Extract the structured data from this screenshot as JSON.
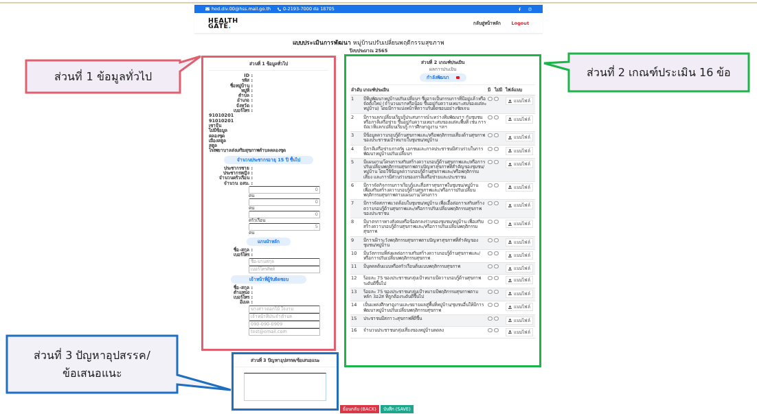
{
  "topbar": {
    "email": "hed.div.00@hss.mail.go.th",
    "phone": "0-2193-7000 ต่อ 18705"
  },
  "header": {
    "logo": {
      "line_1": "HEALTH",
      "line_2": "GATE",
      "dot": "."
    },
    "nav": [
      {
        "label": "กลับสู่หน้าหลัก",
        "kind": "link"
      },
      {
        "label": "Logout",
        "kind": "logout"
      }
    ]
  },
  "form": {
    "title": "**แบบประเมินการพัฒนา** หมู่บ้านปรับเปลี่ยนพฤติกรรมสุขภาพ",
    "subtitle": "ปีงบประมาณ 2565",
    "part_1": {
      "heading": "ส่วนที่ 1 ข้อมูลทั่วไป",
      "info_labels": [
        "ID :",
        "รหัส :",
        "ชื่อหมู่บ้าน :",
        "หมู่ที่ :",
        "ตำบล :",
        "อำเภอ :",
        "จังหวัด :",
        "เบอร์โทร :"
      ],
      "info_values": [
        "91010201",
        "91010201",
        "เขาจีน",
        "ไม่มีข้อมูล",
        "คลองขุด",
        "เมืองสตูล",
        "สตูล",
        "โรงพยาบาลส่งเสริมสุขภาพตำบลคลองขุด"
      ],
      "population": {
        "heading": "จำนวนประชากรอายุ 15 ปี ขึ้นไป",
        "labels": [
          "ประชากรชาย :",
          "ประชากรหญิง :",
          "จำนวนครัวเรือน :",
          "จำนวน อสม. :"
        ],
        "inputs": [
          {
            "value": "0",
            "unit": "คน"
          },
          {
            "value": "0",
            "unit": "คน"
          },
          {
            "value": "0",
            "unit": "ครัวเรือน"
          },
          {
            "value": "5",
            "unit": "คน"
          }
        ]
      },
      "leader": {
        "heading": "แกนนำหลัก",
        "labels": [
          "ชื่อ-สกุล :",
          "เบอร์โทร :"
        ],
        "placeholders": [
          "ชื่อ-นามสกุล",
          "เบอร์โทรศัพท์"
        ]
      },
      "officer": {
        "heading": "เจ้าหน้าที่ผู้รับผิดชอบ",
        "labels": [
          "ชื่อ-สกุล :",
          "ตำแหน่ง :",
          "เบอร์โทร :",
          "อีเมล :"
        ],
        "placeholders": [
          "นางสาวดอกไม้ ใจงาม",
          "เจ้าหน้าที่ประจำตำบล",
          "090-090-0909",
          "test@email.com"
        ]
      }
    },
    "part_2": {
      "heading": "ส่วนที่ 2 เกณฑ์ประเมิน",
      "result_label": "ผลการประเมิน",
      "result": {
        "label": "กำลังพัฒนา",
        "color": "#e8141b"
      },
      "columns": [
        "ลำดับ",
        "เกณฑ์ประเมิน",
        "มี",
        "ไม่มี",
        "ไฟล์แนบ"
      ],
      "rows": [
        {
          "no": "1",
          "criterion": "มีทีมพัฒนาหมู่บ้านปรับเปลี่ยนฯ ซึ่งอาจเป็นกรรมการที่มีอยู่แล้วหรือจัดตั้งใหม่ (จำนวนมากหรือน้อย ขึ้นอยู่กับความเหมาะสมของแต่ละหมู่บ้าน) โดยมีการแบ่งหน้าที่ความรับผิดชอบอย่างชัดเจน",
          "radios": [
            {
              "selected": false
            },
            {
              "selected": false
            }
          ],
          "attach": "แนบไฟล์"
        },
        {
          "no": "2",
          "criterion": "มีการแลกเปลี่ยนเรียนรู้ประสบการณ์ระหว่างทีมพัฒนาฯ กับชุมชนหรือภาคีเครือข่าย ขึ้นอยู่กับความเหมาะสมของแต่ละพื้นที่ เช่น การจัดเวทีแลกเปลี่ยนเรียนรู้ การศึกษาดูงาน ฯลฯ",
          "radios": [
            {
              "selected": false
            },
            {
              "selected": false
            }
          ],
          "attach": "แนบไฟล์"
        },
        {
          "no": "3",
          "criterion": "มีข้อมูลความรอบรู้ด้านสุขภาพและ/หรือพฤติกรรมเสี่ยงด้านสุขภาพของประชาชนเป้าหมายในชุมชน/หมู่บ้าน",
          "radios": [
            {
              "selected": false
            },
            {
              "selected": false
            }
          ],
          "attach": "แนบไฟล์"
        },
        {
          "no": "4",
          "criterion": "มีภาคีเครือข่ายภาครัฐ เอกชนและภาคประชาชนมีส่วนร่วมในการพัฒนาหมู่บ้านปรับเปลี่ยนฯ",
          "radios": [
            {
              "selected": false
            },
            {
              "selected": false
            }
          ],
          "attach": "แนบไฟล์"
        },
        {
          "no": "5",
          "criterion": "มีแผนงาน/โครงการเสริมสร้างความรอบรู้ด้านสุขภาพและ/หรือการปรับเปลี่ยนพฤติกรรมสุขภาพตามปัญหาสุขภาพที่สำคัญของชุมชน/หมู่บ้าน โดยใช้ข้อมูลความรอบรู้ด้านสุขภาพและ/หรือพฤติกรรมเสี่ยง และการมีส่วนร่วมของภาคีเครือข่ายและประชาชน",
          "radios": [
            {
              "selected": false
            },
            {
              "selected": false
            }
          ],
          "attach": "แนบไฟล์"
        },
        {
          "no": "6",
          "criterion": "มีการจัดกิจกรรมการเรียนรู้และสื่อสารสุขภาพในชุมชน/หมู่บ้าน เพื่อเสริมสร้างความรอบรู้ด้านสุขภาพและ/หรือการปรับเปลี่ยนพฤติกรรมสุขภาพตามแผนงาน/โครงการ",
          "radios": [
            {
              "selected": false
            },
            {
              "selected": false
            }
          ],
          "attach": "แนบไฟล์"
        },
        {
          "no": "7",
          "criterion": "มีการจัดสภาพแวดล้อมในชุมชน/หมู่บ้าน เพื่อเอื้อต่อการเสริมสร้างความรอบรู้ด้านสุขภาพและ/หรือการปรับเปลี่ยนพฤติกรรมสุขภาพของประชาชน",
          "radios": [
            {
              "selected": false
            },
            {
              "selected": false
            }
          ],
          "attach": "แนบไฟล์"
        },
        {
          "no": "8",
          "criterion": "มีมาตรการทางสังคมหรือข้อตกลงร่วมของชุมชน/หมู่บ้าน เพื่อเสริมสร้างความรอบรู้ด้านสุขภาพและ/หรือการปรับเปลี่ยนพฤติกรรมสุขภาพ",
          "radios": [
            {
              "selected": false
            },
            {
              "selected": false
            }
          ],
          "attach": "แนบไฟล์"
        },
        {
          "no": "9",
          "criterion": "มีการเฝ้าระวังพฤติกรรมสุขภาพตามปัญหาสุขภาพที่สำคัญของชุมชน/หมู่บ้าน",
          "radios": [
            {
              "selected": false
            },
            {
              "selected": false
            }
          ],
          "attach": "แนบไฟล์"
        },
        {
          "no": "10",
          "criterion": "มีนวัตกรรมที่ส่งผลต่อการเสริมสร้างความรอบรู้ด้านสุขภาพและ/หรือการปรับเปลี่ยนพฤติกรรมสุขภาพ",
          "radios": [
            {
              "selected": false
            },
            {
              "selected": false
            }
          ],
          "attach": "แนบไฟล์"
        },
        {
          "no": "11",
          "criterion": "มีบุคคลต้นแบบหรือครัวเรือนต้นแบบพฤติกรรมสุขภาพ",
          "radios": [
            {
              "selected": false
            },
            {
              "selected": false
            }
          ],
          "attach": "แนบไฟล์"
        },
        {
          "no": "12",
          "criterion": "ร้อยละ 75 ของประชาชนกลุ่มเป้าหมายมีความรอบรู้ด้านสุขภาพระดับดีขึ้นไป",
          "radios": [
            {
              "selected": false
            },
            {
              "selected": false
            }
          ],
          "attach": "แนบไฟล์"
        },
        {
          "no": "13",
          "criterion": "ร้อยละ 75 ของประชาชนกลุ่มเป้าหมายมีพฤติกรรมสุขภาพตามหลัก 3อ2ส ที่ถูกต้องระดับดีขึ้นไป",
          "radios": [
            {
              "selected": false
            },
            {
              "selected": false
            }
          ],
          "attach": "แนบไฟล์"
        },
        {
          "no": "14",
          "criterion": "เป็นแหล่งศึกษาดูงานและขยายผลสู่พื้นที่หมู่บ้าน/ชุมชนอื่นให้มีการพัฒนาหมู่บ้านปรับเปลี่ยนพฤติกรรมสุขภาพ",
          "radios": [
            {
              "selected": false
            },
            {
              "selected": false
            }
          ],
          "attach": "แนบไฟล์"
        },
        {
          "no": "15",
          "criterion": "ประชาชนมีสภาวะสุขภาพที่ดีขึ้น",
          "radios": [
            {
              "selected": false
            },
            {
              "selected": false
            }
          ],
          "attach": "แนบไฟล์"
        },
        {
          "no": "16",
          "criterion": "จำนวนประชาชนกลุ่มเสี่ยงของหมู่บ้านลดลง",
          "radios": [
            {
              "selected": false
            },
            {
              "selected": false
            }
          ],
          "attach": "แนบไฟล์"
        }
      ]
    },
    "part_3": {
      "heading": "ส่วนที่ 3 ปัญหาอุปสรรค/ข้อเสนอแนะ"
    },
    "buttons": [
      {
        "label": "ย้อนกลับ (BACK)",
        "kind": "back"
      },
      {
        "label": "บันทึก (SAVE)",
        "kind": "save"
      }
    ]
  },
  "annotations": [
    {
      "kind": "part_1",
      "lines": [
        "ส่วนที่ 1 ข้อมูลทั่วไป"
      ]
    },
    {
      "kind": "part_2",
      "lines": [
        "ส่วนที่ 2 เกณฑ์ประเมิน 16 ข้อ"
      ]
    },
    {
      "kind": "part_3",
      "lines": [
        "ส่วนที่ 3 ปัญหาอุปสรรค/",
        "ข้อเสนอแนะ"
      ]
    }
  ]
}
